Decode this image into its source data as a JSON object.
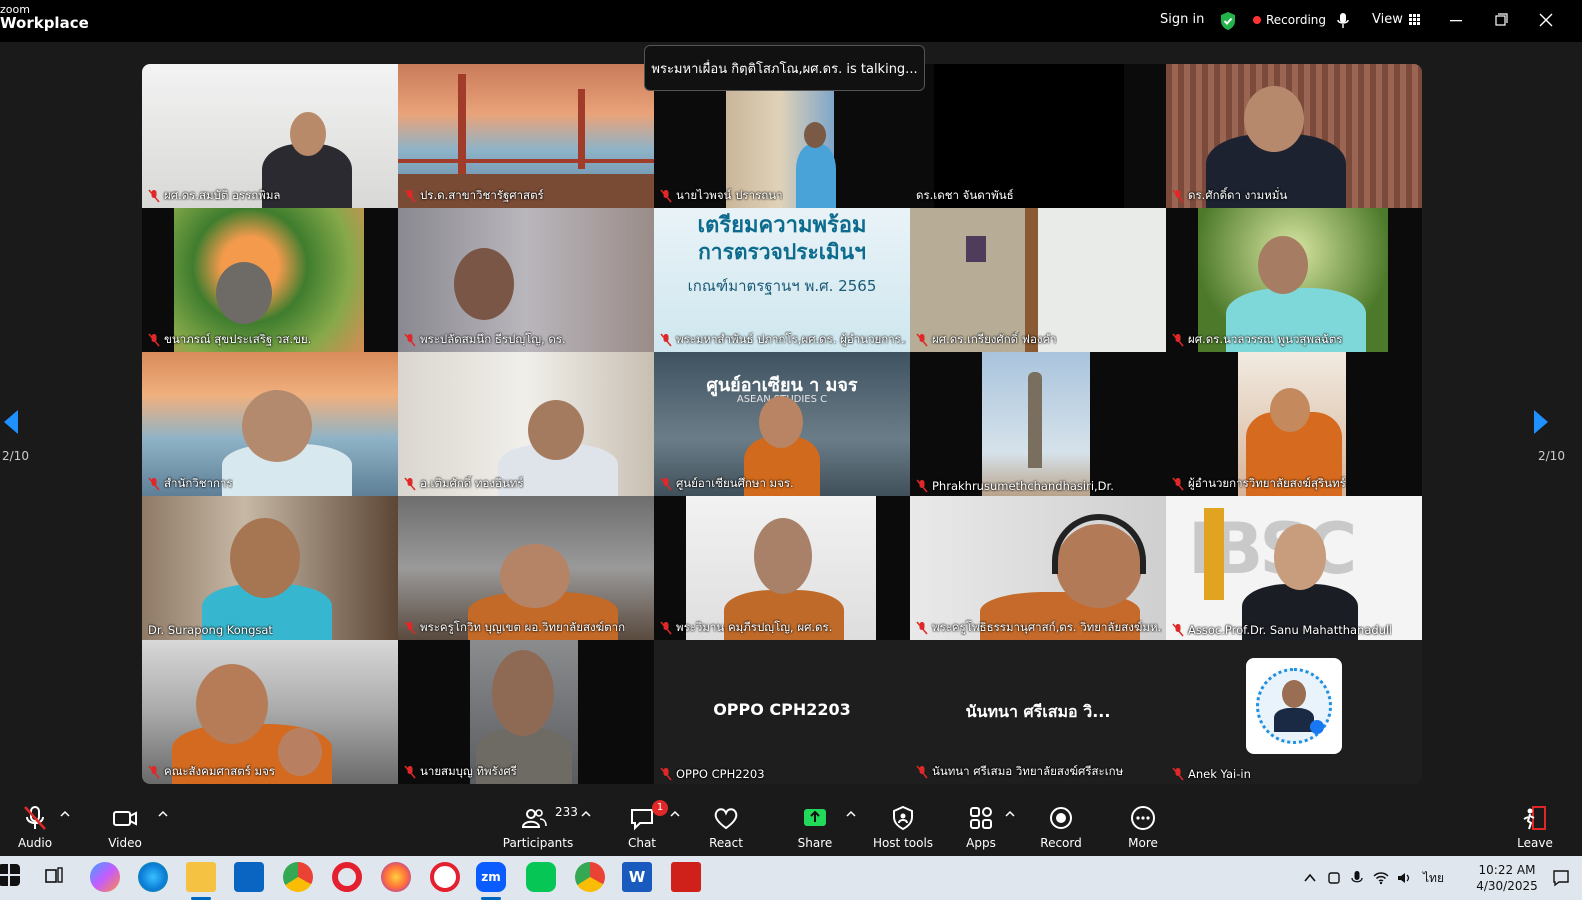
{
  "app": {
    "brand_small": "zoom",
    "brand_large": "Workplace"
  },
  "topbar": {
    "sign_in": "Sign in",
    "recording": "Recording",
    "view": "View"
  },
  "talking_banner": "พระมหาเผื่อน กิตฺติโสภโณ,ผศ.ดร. is talking...",
  "pagination": {
    "left": "2/10",
    "right": "2/10"
  },
  "participants": [
    {
      "name": "ผศ.ดร.สมบัติ อรรถพิมล"
    },
    {
      "name": "ปร.ด.สาขาวิชารัฐศาสตร์"
    },
    {
      "name": "นายไวพจน์ ปรารถนา"
    },
    {
      "name": "ดร.เดชา จันดาพันธ์"
    },
    {
      "name": "ดร.ศักดิ์ดา งามหมั่น"
    },
    {
      "name": "ขนาภรณ์ สุขประเสริฐ วส.ขย."
    },
    {
      "name": "พระปลัดสมนึก ธีรปญฺโญ, ดร."
    },
    {
      "name": "พระมหาสำพันธ์ ปภากโร,ผศ.ดร. ผู้อำนวยการ...",
      "tile_title_1": "เตรียมความพร้อม",
      "tile_title_2": "การตรวจประเมินฯ",
      "tile_title_3": "เกณฑ์มาตรฐานฯ พ.ศ. 2565"
    },
    {
      "name": "ผศ.ดร.เกรียงศักดิ์ ฟองคำ"
    },
    {
      "name": "ผศ.ดร.นวลวรรณ พูนวสุพลฉัตร"
    },
    {
      "name": "สำนักวิชาการ"
    },
    {
      "name": "อ.เติมศักดิ์ ทองอินทร์"
    },
    {
      "name": "ศูนย์อาเซียนศึกษา มจร.",
      "tile_title_1": "ศูนย์อาเซียน    า มจร",
      "tile_title_2": "ASEAN STUDIES C"
    },
    {
      "name": "Phrakhrusumethchandhasiri,Dr."
    },
    {
      "name": "ผู้อำนวยการวิทยาลัยสงฆ์สุรินทร์"
    },
    {
      "name": "Dr. Surapong Kongsat"
    },
    {
      "name": "พระครูโกวิท บุญเขต ผอ.วิทยาลัยสงฆ์ตาก"
    },
    {
      "name": "พระวิมาน คมฺภีรปญฺโญ, ผศ.ดร."
    },
    {
      "name": "พระครูโพธิธรรมานุศาสก์,ดร. วิทยาลัยสงฆ์มห..."
    },
    {
      "name": "Assoc.Prof.Dr. Sanu Mahatthanadull",
      "tile_title_1": "IBSC"
    },
    {
      "name": "คณะสังคมศาสตร์ มจร"
    },
    {
      "name": "นายสมบุญ ทิพรังศรี"
    },
    {
      "name": "OPPO CPH2203",
      "center": "OPPO CPH2203"
    },
    {
      "name": "นันทนา ศรีเสมอ วิทยาลัยสงฆ์ศรีสะเกษ",
      "center": "นันทนา ศรีเสมอ วิ..."
    },
    {
      "name": "Anek Yai-in"
    }
  ],
  "toolbar": {
    "audio": "Audio",
    "video": "Video",
    "participants": "Participants",
    "participants_count": "233",
    "chat": "Chat",
    "chat_badge": "1",
    "react": "React",
    "share": "Share",
    "host_tools": "Host tools",
    "apps": "Apps",
    "record": "Record",
    "more": "More",
    "leave": "Leave"
  },
  "taskbar": {
    "time": "10:22 AM",
    "date": "4/30/2025",
    "lang": "ไทย"
  },
  "colors": {
    "accent": "#0e72ed",
    "recording": "#ff3333",
    "mute": "#e02828",
    "share": "#23d959"
  }
}
